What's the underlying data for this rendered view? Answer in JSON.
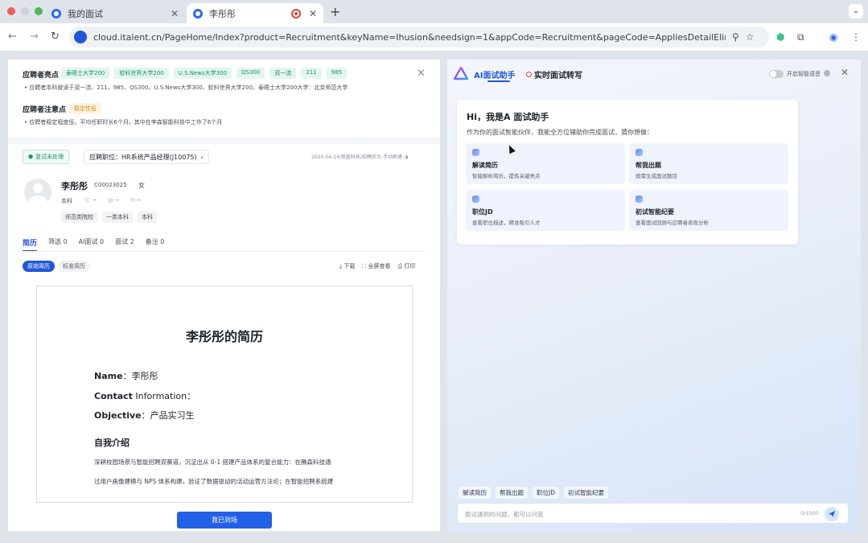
{
  "browser": {
    "tabs": [
      {
        "title": "我的面试"
      },
      {
        "title": "李彤彤"
      }
    ],
    "url": "cloud.italent.cn/PageHome/Index?product=Recruitment&keyName=Ihusion&needsign=1&appCode=Recruitment&pageCode=AppliesDetailElinkPage&applyId=5..."
  },
  "highlights": {
    "title": "应聘者亮点",
    "chips": [
      "泰晤士大学200",
      "软科世界大学200",
      "U.S.News大学300",
      "QS300",
      "双一流",
      "211",
      "985"
    ],
    "text": "应聘者本科就读于双一流、211、985、QS300、U.S.News大学300、软科世界大学200、泰晤士大学200大学：北京师范大学"
  },
  "notice": {
    "title": "应聘者注意点",
    "chip": "稳定性低",
    "text": "应聘者稳定程度低，平均任职时长6个月，其中在李森智能科技中工作了6个月"
  },
  "application": {
    "status": "复试未处理",
    "position": "应聘职位：HR系统产品经理(J10075)",
    "meta": "2025-04-14/简盈科技/招聘后台-手动新建"
  },
  "candidate": {
    "name": "李彤彤",
    "id": "C00023025",
    "gender": "女",
    "degree": "本科",
    "phone": "--",
    "id_card": "--",
    "email": "--",
    "tags": [
      "师范类院校",
      "一类本科",
      "本科"
    ]
  },
  "detail_tabs": [
    {
      "label": "简历"
    },
    {
      "label": "筛选 0"
    },
    {
      "label": "AI面试 0"
    },
    {
      "label": "面试 2"
    },
    {
      "label": "备注 0"
    }
  ],
  "resume_view": {
    "modes": [
      "原始简历",
      "标准简历"
    ],
    "download": "下载",
    "fullscreen": "全屏查看",
    "print": "打印"
  },
  "resume": {
    "title": "李彤彤的简历",
    "name_label": "Name",
    "name_value": "：李彤彤",
    "contact_label": "Contact",
    "contact_value": " Information：",
    "objective_label": "Objective",
    "objective_value": "：产品实习生",
    "intro_title": "自我介绍",
    "intro_line1": "深耕校园场景与智能招聘双赛道，沉淀出从 0-1 搭建产品体系的复合能力：在腾森科技通",
    "intro_line2": "过用户画像建模与 NPS 体系构建，验证了数据驱动的活动运营方法论；在智能招聘系统建"
  },
  "primary_action": "我已到场",
  "ai_panel": {
    "tab_assistant": "AI面试助手",
    "tab_realtime": "实时面试转写",
    "toggle_label": "开启智能语音",
    "greeting": "Hi，我是A 面试助手",
    "subtitle": "作为你的面试智能伙伴，我能全方位辅助你完成面试，猜你想做：",
    "features": [
      {
        "label": "解读简历",
        "desc": "智能解析简历，提炼关键亮点"
      },
      {
        "label": "帮我出题",
        "desc": "按需生成面试题目"
      },
      {
        "label": "职位JD",
        "desc": "查看职位描述，精准吸引人才"
      },
      {
        "label": "初试智能纪要",
        "desc": "查看面试回顾与应聘者表现分析"
      }
    ],
    "quick_actions": [
      "解读简历",
      "帮我出题",
      "职位JD",
      "初试智能纪要"
    ],
    "input_placeholder": "面试遇到的问题，都可以问我",
    "counter": "0/1000"
  }
}
